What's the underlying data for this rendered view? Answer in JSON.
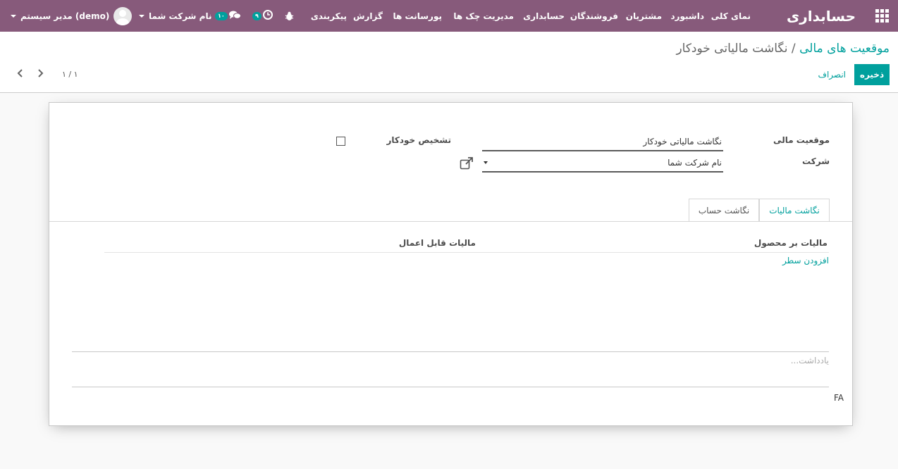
{
  "topbar": {
    "brand": "حسابداری",
    "menu": [
      "نمای کلی",
      "داشبورد",
      "مشتریان",
      "فروشندگان",
      "حسابداری",
      "مدیریت چک ها",
      "پورسانت ها",
      "گزارش",
      "پیکربندی"
    ],
    "activity_count": "۹",
    "messages_count": "۱۰",
    "company": "نام شرکت شما",
    "user": "مدیر سیستم (demo)"
  },
  "control_panel": {
    "breadcrumb_parent": "موقعیت های مالی",
    "breadcrumb_sep": "/",
    "breadcrumb_current": "نگاشت مالیاتی خودکار",
    "save_label": "ذخیره",
    "discard_label": "انصراف",
    "pager": "۱ / ۱"
  },
  "form": {
    "fiscal_position_label": "موقعیت مالی",
    "fiscal_position_value": "نگاشت مالیاتی خودکار",
    "company_label": "شرکت",
    "company_value": "نام شرکت شما",
    "auto_detect_label": "تشخیص خودکار",
    "auto_detect_checked": false,
    "tabs": [
      "نگاشت مالیات",
      "نگاشت حساب"
    ],
    "active_tab": 0,
    "columns": [
      "مالیات بر محصول",
      "مالیات قابل اعمال"
    ],
    "add_line": "افزودن سطر",
    "note_placeholder": "یادداشت...",
    "footer_code": "FA"
  },
  "colors": {
    "topbar": "#875a7b",
    "accent": "#00a09d"
  }
}
